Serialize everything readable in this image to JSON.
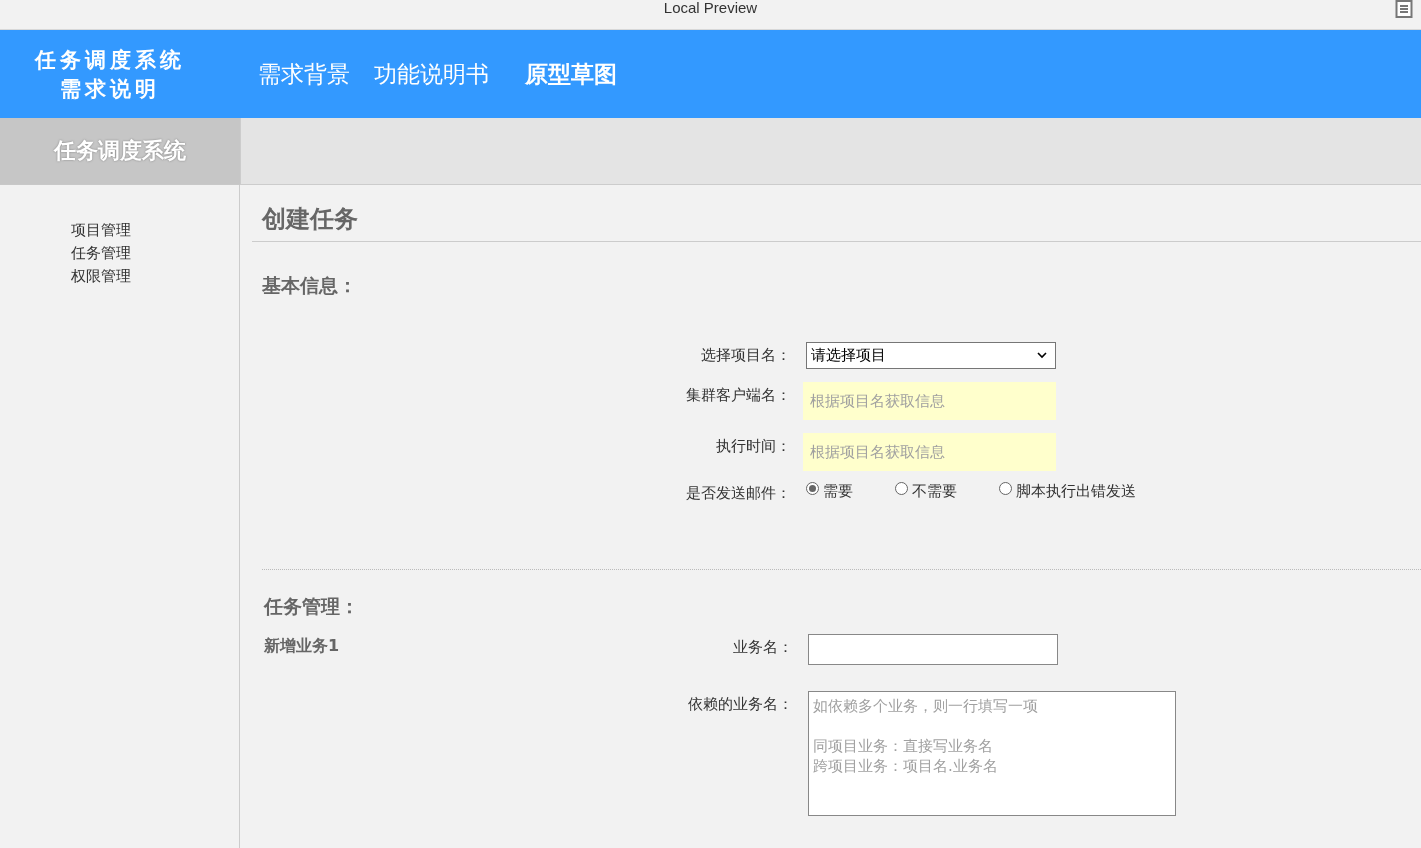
{
  "window": {
    "title": "Local Preview"
  },
  "header": {
    "logo_lines": [
      "任务调度系统",
      "需求说明"
    ],
    "nav": [
      {
        "label": "需求背景",
        "selected": false
      },
      {
        "label": "功能说明书",
        "selected": false
      },
      {
        "label": "原型草图",
        "selected": true
      }
    ]
  },
  "sidebar": {
    "title": "任务调度系统",
    "items": [
      "项目管理",
      "任务管理",
      "权限管理"
    ]
  },
  "page": {
    "title": "创建任务"
  },
  "basic": {
    "heading": "基本信息：",
    "fields": [
      {
        "kind": "select",
        "label": "选择项目名：",
        "value": "请选择项目"
      },
      {
        "kind": "readonly",
        "label": "集群客户端名：",
        "placeholder": "根据项目名获取信息"
      },
      {
        "kind": "readonly",
        "label": "执行时间：",
        "placeholder": "根据项目名获取信息"
      },
      {
        "kind": "radio",
        "label": "是否发送邮件：",
        "options": [
          {
            "label": "需要",
            "selected": true
          },
          {
            "label": "不需要",
            "selected": false
          },
          {
            "label": "脚本执行出错发送",
            "selected": false
          }
        ]
      }
    ]
  },
  "tasks": {
    "heading": "任务管理：",
    "item_title": "新增业务1",
    "fields": [
      {
        "kind": "text",
        "label": "业务名："
      },
      {
        "kind": "textarea",
        "label": "依赖的业务名：",
        "placeholder": [
          "如依赖多个业务，则一行填写一项",
          "同项目业务：直接写业务名",
          "跨项目业务：项目名.业务名"
        ]
      }
    ]
  }
}
